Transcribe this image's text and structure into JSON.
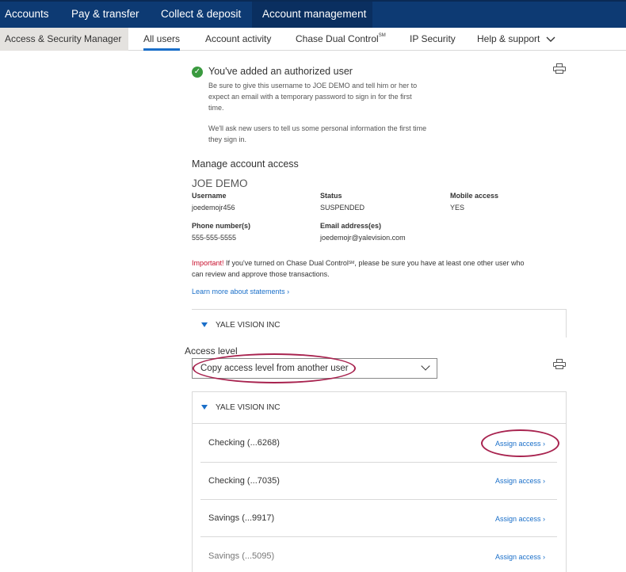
{
  "topnav": {
    "items": [
      "Accounts",
      "Pay & transfer",
      "Collect & deposit",
      "Account management"
    ]
  },
  "subnav": {
    "section": "Access & Security Manager",
    "tabs": [
      "All users",
      "Account activity",
      "Chase Dual Control",
      "IP Security",
      "Help & support"
    ],
    "dual_control_sup": "SM"
  },
  "success": {
    "title": "You've added an authorized user",
    "line1": "Be sure to give this username to JOE DEMO and tell him or her to",
    "line2": "expect an email with a temporary password to sign in for the first",
    "line3": "time.",
    "line4": "We'll ask new users to tell us some personal information the first time",
    "line5": "they sign in."
  },
  "manage": {
    "title": "Manage account access",
    "name": "JOE DEMO",
    "username_label": "Username",
    "username": "joedemojr456",
    "status_label": "Status",
    "status": "SUSPENDED",
    "mobile_label": "Mobile access",
    "mobile": "YES",
    "phone_label": "Phone number(s)",
    "phone": "555-555-5555",
    "email_label": "Email address(es)",
    "email": "joedemojr@yalevision.com"
  },
  "important": {
    "prefix": "Important!",
    "text1": " If you've turned on Chase Dual Control",
    "sup": "SM",
    "text2": ", please be sure you have at least one other user who",
    "line2": "can review and approve those transactions."
  },
  "learn_link": "Learn more about statements",
  "company": "YALE VISION INC",
  "access": {
    "label": "Access level",
    "selected": "Copy access level from another user"
  },
  "accounts": [
    {
      "name": "Checking (...6268)",
      "action": "Assign access"
    },
    {
      "name": "Checking (...7035)",
      "action": "Assign access"
    },
    {
      "name": "Savings (...9917)",
      "action": "Assign access"
    },
    {
      "name": "Savings (...5095)",
      "action": "Assign access"
    }
  ],
  "colors": {
    "nav_bg": "#0d3a73",
    "link": "#1a6fc9",
    "success": "#3a9a3f",
    "important": "#c8102e",
    "annotation": "#a8234f"
  },
  "icons": [
    "check-icon",
    "printer-icon",
    "chevron-down-icon",
    "chevron-right-icon",
    "triangle-down-icon"
  ]
}
